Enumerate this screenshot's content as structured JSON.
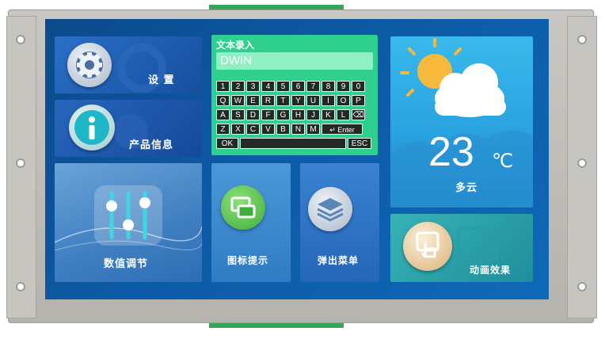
{
  "colors": {
    "screen_bg": "#0d5aa6",
    "keyboard_bg": "#2fd08e",
    "weather_bg": "#2aa3e0",
    "settings_tile": "#1e5fb5",
    "product_tile": "#1d57ad",
    "slider_tile": "#4a87c7",
    "icon_tile": "#3d8ad0",
    "popup_tile": "#2f74c6",
    "animation_tile": "#2ea5a8",
    "bezel": "#c1bfba"
  },
  "tiles": {
    "settings": {
      "label": "设 置",
      "icon": "gear-icon"
    },
    "product_info": {
      "label": "产品信息",
      "icon": "info-icon"
    },
    "sliders": {
      "label": "数值调节",
      "icon": "sliders-icon"
    },
    "icon_hint": {
      "label": "图标提示",
      "icon": "window-icon"
    },
    "popup_menu": {
      "label": "弹出菜单",
      "icon": "layers-icon"
    },
    "animation": {
      "label": "动画效果",
      "icon": "touch-icon"
    }
  },
  "keyboard": {
    "title": "文本录入",
    "input_value": "DWIN",
    "rows": [
      [
        "1",
        "2",
        "3",
        "4",
        "5",
        "6",
        "7",
        "8",
        "9",
        "0"
      ],
      [
        "Q",
        "W",
        "E",
        "R",
        "T",
        "Y",
        "U",
        "I",
        "O",
        "P"
      ],
      [
        "A",
        "S",
        "D",
        "F",
        "G",
        "H",
        "J",
        "K",
        "L",
        "⌫"
      ],
      [
        "Z",
        "X",
        "C",
        "V",
        "B",
        "N",
        "M",
        "↵ Enter"
      ]
    ],
    "ok_label": "OK",
    "esc_label": "ESC"
  },
  "weather": {
    "temperature": "23",
    "unit": "℃",
    "condition": "多云",
    "icon": "partly-cloudy-icon"
  }
}
